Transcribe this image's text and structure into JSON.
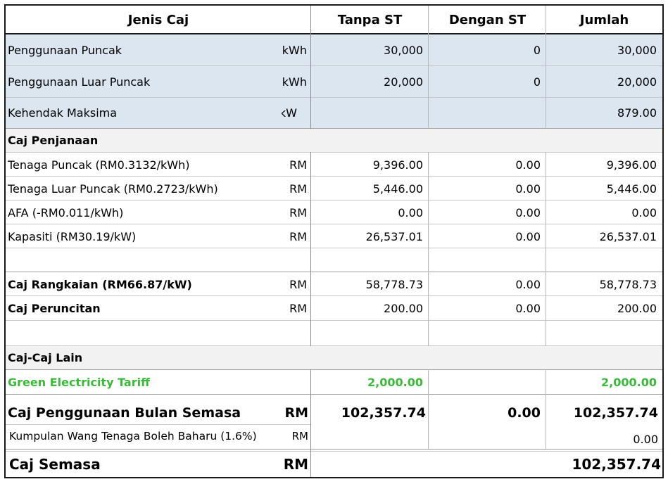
{
  "header": {
    "col_jenis": "Jenis Caj",
    "col_tanpa": "Tanpa ST",
    "col_dengan": "Dengan ST",
    "col_jumlah": "Jumlah"
  },
  "usage": [
    {
      "label": "Penggunaan Puncak",
      "unit": "kWh",
      "tanpa": "30,000",
      "dengan": "0",
      "jumlah": "30,000"
    },
    {
      "label": "Penggunaan Luar Puncak",
      "unit": "kWh",
      "tanpa": "20,000",
      "dengan": "0",
      "jumlah": "20,000"
    },
    {
      "label": "Kehendak Maksima",
      "unit": "kW",
      "tanpa": "",
      "dengan": "",
      "jumlah": "879.00"
    }
  ],
  "sections": {
    "penjanaan": "Caj Penjanaan",
    "lain": "Caj-Caj Lain"
  },
  "penjanaan_rows": [
    {
      "label": "Tenaga Puncak  (RM0.3132/kWh)",
      "unit": "RM",
      "tanpa": "9,396.00",
      "dengan": "0.00",
      "jumlah": "9,396.00"
    },
    {
      "label": "Tenaga Luar Puncak (RM0.2723/kWh)",
      "unit": "RM",
      "tanpa": "5,446.00",
      "dengan": "0.00",
      "jumlah": "5,446.00"
    },
    {
      "label": "AFA (-RM0.011/kWh)",
      "unit": "RM",
      "tanpa": "0.00",
      "dengan": "0.00",
      "jumlah": "0.00"
    },
    {
      "label": "Kapasiti (RM30.19/kW)",
      "unit": "RM",
      "tanpa": "26,537.01",
      "dengan": "0.00",
      "jumlah": "26,537.01"
    }
  ],
  "rangkaian": {
    "label": "Caj Rangkaian (RM66.87/kW)",
    "unit": "RM",
    "tanpa": "58,778.73",
    "dengan": "0.00",
    "jumlah": "58,778.73"
  },
  "peruncitan": {
    "label": "Caj Peruncitan",
    "unit": "RM",
    "tanpa": "200.00",
    "dengan": "0.00",
    "jumlah": "200.00"
  },
  "green": {
    "label": "Green Electricity Tariff",
    "tanpa": "2,000.00",
    "jumlah": "2,000.00",
    "color": "#3cb83c"
  },
  "bulan_semasa": {
    "label": "Caj Penggunaan Bulan Semasa",
    "unit": "RM",
    "tanpa": "102,357.74",
    "dengan": "0.00",
    "jumlah": "102,357.74"
  },
  "kwtbb": {
    "label": "Kumpulan Wang Tenaga Boleh Baharu (1.6%)",
    "unit": "RM",
    "jumlah": "0.00"
  },
  "semasa": {
    "label": "Caj Semasa",
    "unit": "RM",
    "jumlah": "102,357.74"
  }
}
